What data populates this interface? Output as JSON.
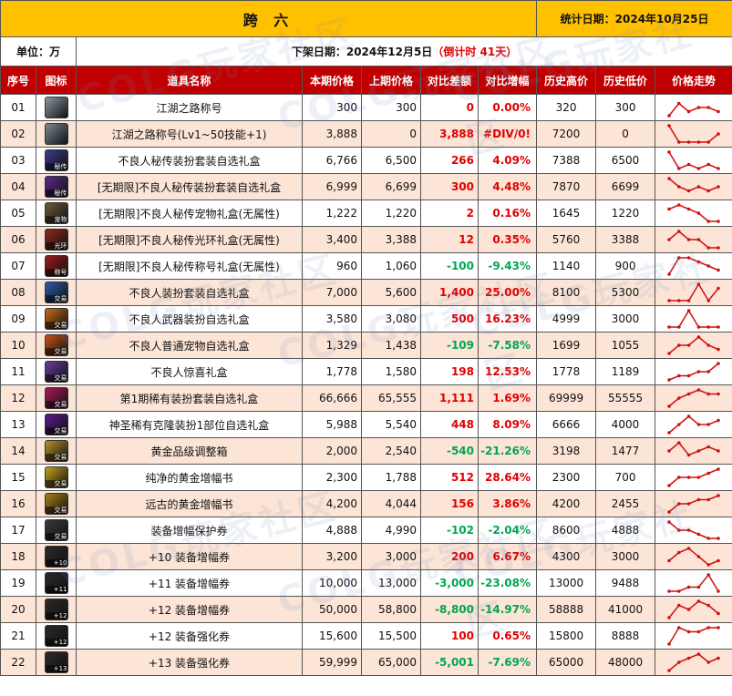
{
  "header": {
    "title": "跨 六",
    "stat_date": "统计日期：2024年10月25日",
    "unit": "单位：万",
    "removal_date": "下架日期：2024年12月5日",
    "countdown": "（倒计时 41天）"
  },
  "columns": [
    "序号",
    "图标",
    "道具名称",
    "本期价格",
    "上期价格",
    "对比差额",
    "对比增幅",
    "历史高价",
    "历史低价",
    "价格走势"
  ],
  "watermark": "COLG玩家社区",
  "rows": [
    {
      "no": "01",
      "name": "江湖之路称号",
      "cur": "300",
      "prev": "300",
      "diff": "0",
      "pct": "0.00%",
      "dir": "up",
      "high": "320",
      "low": "300",
      "icon_color": "#8a9aa3",
      "icon_label": "",
      "trend": [
        5,
        2,
        4,
        3,
        3,
        4
      ]
    },
    {
      "no": "02",
      "name": "江湖之路称号(Lv1~50技能+1)",
      "cur": "3,888",
      "prev": "0",
      "diff": "3,888",
      "pct": "#DIV/0!",
      "dir": "up",
      "high": "7200",
      "low": "0",
      "icon_color": "#7c8a93",
      "icon_label": "",
      "trend": [
        1,
        5,
        5,
        5,
        5,
        3
      ]
    },
    {
      "no": "03",
      "name": "不良人秘传装扮套装自选礼盒",
      "cur": "6,766",
      "prev": "6,500",
      "diff": "266",
      "pct": "4.09%",
      "dir": "up",
      "high": "7388",
      "low": "6500",
      "icon_color": "#3a3a8c",
      "icon_label": "秘传",
      "trend": [
        1,
        5,
        4,
        5,
        4,
        5
      ]
    },
    {
      "no": "04",
      "name": "[无期限]不良人秘传装扮套装自选礼盒",
      "cur": "6,999",
      "prev": "6,699",
      "diff": "300",
      "pct": "4.48%",
      "dir": "up",
      "high": "7870",
      "low": "6699",
      "icon_color": "#5a2a8c",
      "icon_label": "秘传",
      "trend": [
        1,
        3,
        4,
        3,
        4,
        3
      ]
    },
    {
      "no": "05",
      "name": "[无期限]不良人秘传宠物礼盒(无属性)",
      "cur": "1,222",
      "prev": "1,220",
      "diff": "2",
      "pct": "0.16%",
      "dir": "up",
      "high": "1645",
      "low": "1220",
      "icon_color": "#6e5a3a",
      "icon_label": "宠物",
      "trend": [
        2,
        1,
        2,
        3,
        5,
        5
      ]
    },
    {
      "no": "06",
      "name": "[无期限]不良人秘传光环礼盒(无属性)",
      "cur": "3,400",
      "prev": "3,388",
      "diff": "12",
      "pct": "0.35%",
      "dir": "up",
      "high": "5760",
      "low": "3388",
      "icon_color": "#8c2a1a",
      "icon_label": "光环",
      "trend": [
        3,
        1,
        3,
        3,
        5,
        5
      ]
    },
    {
      "no": "07",
      "name": "[无期限]不良人秘传称号礼盒(无属性)",
      "cur": "960",
      "prev": "1,060",
      "diff": "-100",
      "pct": "-9.43%",
      "dir": "down",
      "high": "1140",
      "low": "900",
      "icon_color": "#9c1a1a",
      "icon_label": "称号",
      "trend": [
        5,
        1,
        1,
        2,
        3,
        4
      ]
    },
    {
      "no": "08",
      "name": "不良人装扮套装自选礼盒",
      "cur": "7,000",
      "prev": "5,600",
      "diff": "1,400",
      "pct": "25.00%",
      "dir": "up",
      "high": "8100",
      "low": "5300",
      "icon_color": "#2a5aa8",
      "icon_label": "交易",
      "trend": [
        5,
        5,
        5,
        1,
        5,
        2
      ]
    },
    {
      "no": "09",
      "name": "不良人武器装扮自选礼盒",
      "cur": "3,580",
      "prev": "3,080",
      "diff": "500",
      "pct": "16.23%",
      "dir": "up",
      "high": "4999",
      "low": "3000",
      "icon_color": "#c86a1a",
      "icon_label": "交易",
      "trend": [
        5,
        5,
        1,
        5,
        5,
        5
      ]
    },
    {
      "no": "10",
      "name": "不良人普通宠物自选礼盒",
      "cur": "1,329",
      "prev": "1,438",
      "diff": "-109",
      "pct": "-7.58%",
      "dir": "down",
      "high": "1699",
      "low": "1055",
      "icon_color": "#c8501a",
      "icon_label": "交易",
      "trend": [
        5,
        3,
        3,
        1,
        3,
        4
      ]
    },
    {
      "no": "11",
      "name": "不良人惊喜礼盒",
      "cur": "1,778",
      "prev": "1,580",
      "diff": "198",
      "pct": "12.53%",
      "dir": "up",
      "high": "1778",
      "low": "1189",
      "icon_color": "#6a3a9c",
      "icon_label": "交易",
      "trend": [
        5,
        4,
        4,
        3,
        3,
        1
      ]
    },
    {
      "no": "12",
      "name": "第1期稀有装扮套装自选礼盒",
      "cur": "66,666",
      "prev": "65,555",
      "diff": "1,111",
      "pct": "1.69%",
      "dir": "up",
      "high": "69999",
      "low": "55555",
      "icon_color": "#a81a5a",
      "icon_label": "交易",
      "trend": [
        5,
        3,
        2,
        1,
        2,
        2
      ]
    },
    {
      "no": "13",
      "name": "神圣稀有克隆装扮1部位自选礼盒",
      "cur": "5,988",
      "prev": "5,540",
      "diff": "448",
      "pct": "8.09%",
      "dir": "up",
      "high": "6666",
      "low": "4000",
      "icon_color": "#5a1a8c",
      "icon_label": "交易",
      "trend": [
        5,
        3,
        1,
        3,
        3,
        2
      ]
    },
    {
      "no": "14",
      "name": "黄金品级调整箱",
      "cur": "2,000",
      "prev": "2,540",
      "diff": "-540",
      "pct": "-21.26%",
      "dir": "down",
      "high": "3198",
      "low": "1477",
      "icon_color": "#b8902a",
      "icon_label": "交易",
      "trend": [
        3,
        1,
        4,
        3,
        2,
        3
      ]
    },
    {
      "no": "15",
      "name": "纯净的黄金增幅书",
      "cur": "2,300",
      "prev": "1,788",
      "diff": "512",
      "pct": "28.64%",
      "dir": "up",
      "high": "2300",
      "low": "700",
      "icon_color": "#c8a01a",
      "icon_label": "交易",
      "trend": [
        5,
        3,
        3,
        3,
        2,
        1
      ]
    },
    {
      "no": "16",
      "name": "远古的黄金增幅书",
      "cur": "4,200",
      "prev": "4,044",
      "diff": "156",
      "pct": "3.86%",
      "dir": "up",
      "high": "4200",
      "low": "2455",
      "icon_color": "#a8801a",
      "icon_label": "交易",
      "trend": [
        5,
        3,
        3,
        2,
        2,
        1
      ]
    },
    {
      "no": "17",
      "name": "装备增幅保护券",
      "cur": "4,888",
      "prev": "4,990",
      "diff": "-102",
      "pct": "-2.04%",
      "dir": "down",
      "high": "8600",
      "low": "4888",
      "icon_color": "#3a3a3a",
      "icon_label": "交易",
      "trend": [
        1,
        3,
        3,
        4,
        5,
        5
      ]
    },
    {
      "no": "18",
      "name": "+10 装备增幅券",
      "cur": "3,200",
      "prev": "3,000",
      "diff": "200",
      "pct": "6.67%",
      "dir": "up",
      "high": "4300",
      "low": "3000",
      "icon_color": "#2a2a2a",
      "icon_label": "+10",
      "trend": [
        4,
        2,
        1,
        3,
        5,
        4
      ]
    },
    {
      "no": "19",
      "name": "+11 装备增幅券",
      "cur": "10,000",
      "prev": "13,000",
      "diff": "-3,000",
      "pct": "-23.08%",
      "dir": "down",
      "high": "13000",
      "low": "9488",
      "icon_color": "#2a2a2a",
      "icon_label": "+11",
      "trend": [
        5,
        5,
        4,
        4,
        1,
        5
      ]
    },
    {
      "no": "20",
      "name": "+12 装备增幅券",
      "cur": "50,000",
      "prev": "58,800",
      "diff": "-8,800",
      "pct": "-14.97%",
      "dir": "down",
      "high": "58888",
      "low": "41000",
      "icon_color": "#2a2a2a",
      "icon_label": "+12",
      "trend": [
        5,
        2,
        3,
        1,
        2,
        4
      ]
    },
    {
      "no": "21",
      "name": "+12 装备强化券",
      "cur": "15,600",
      "prev": "15,500",
      "diff": "100",
      "pct": "0.65%",
      "dir": "up",
      "high": "15800",
      "low": "8888",
      "icon_color": "#2a2a2a",
      "icon_label": "+12",
      "trend": [
        5,
        1,
        2,
        2,
        1,
        1
      ]
    },
    {
      "no": "22",
      "name": "+13 装备强化券",
      "cur": "59,999",
      "prev": "65,000",
      "diff": "-5,001",
      "pct": "-7.69%",
      "dir": "down",
      "high": "65000",
      "low": "48000",
      "icon_color": "#2a2a2a",
      "icon_label": "+13",
      "trend": [
        5,
        3,
        2,
        1,
        3,
        2
      ]
    }
  ]
}
